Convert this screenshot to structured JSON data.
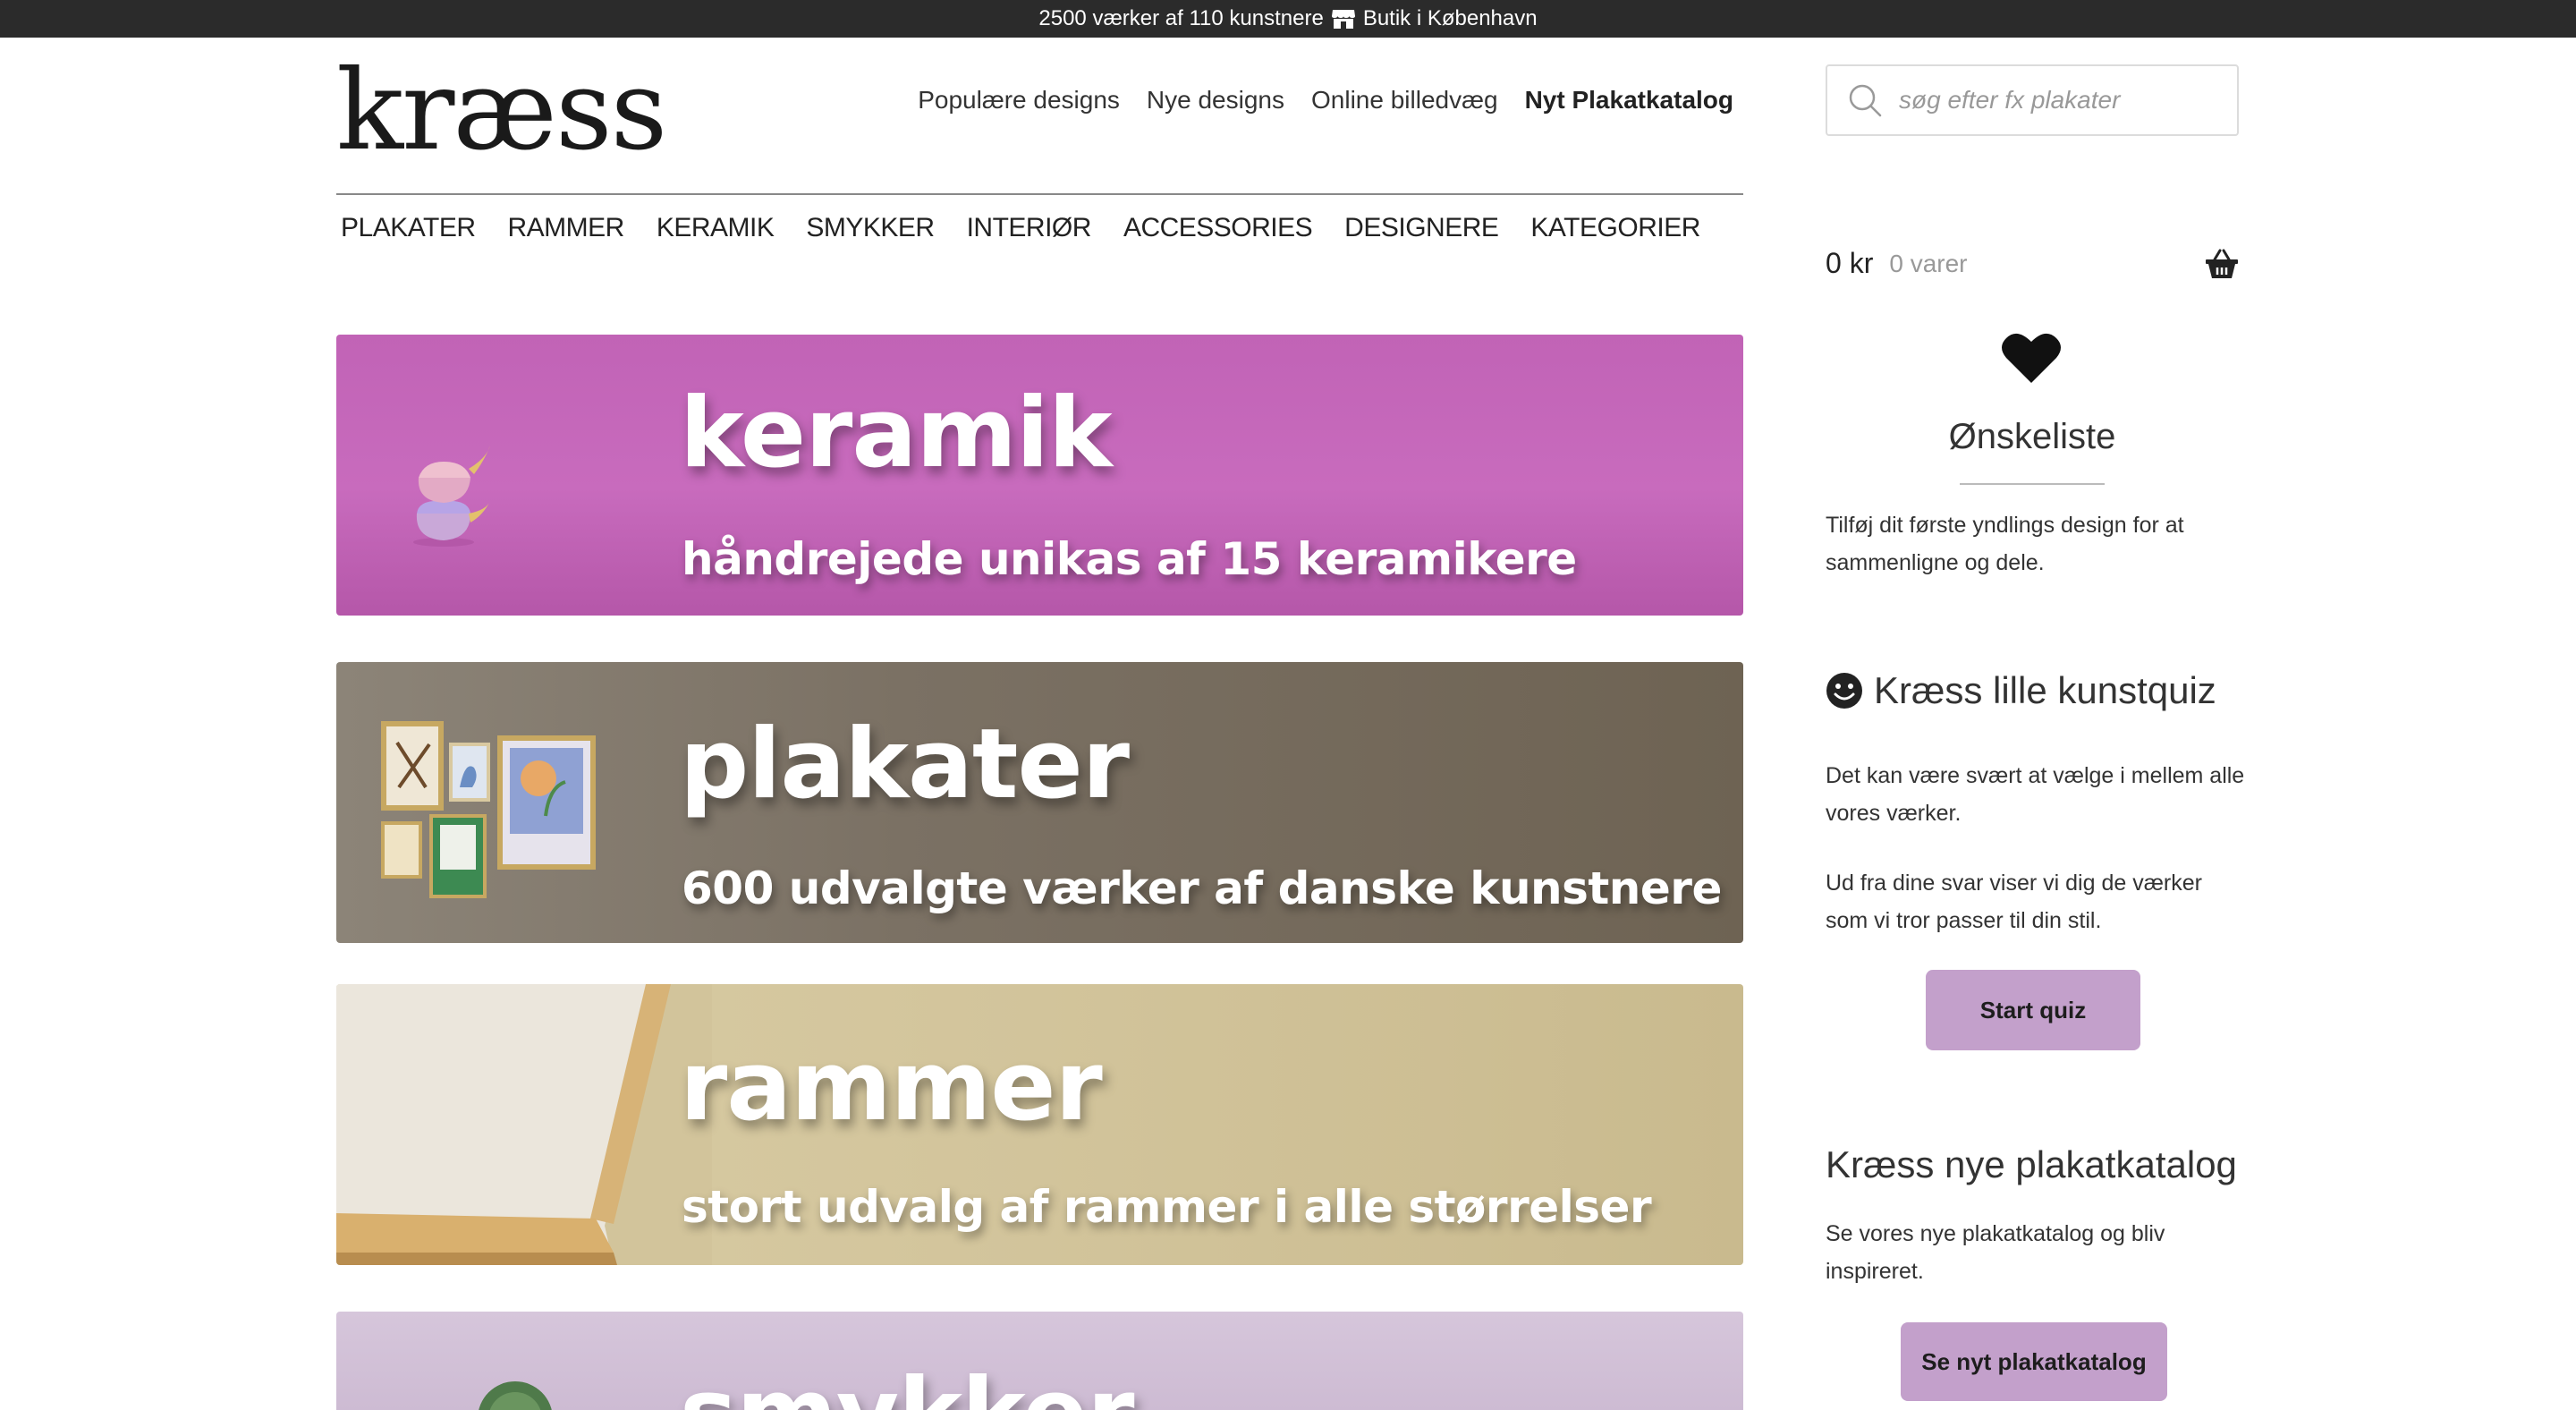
{
  "topbar": {
    "text_left": "2500 værker af 110 kunstnere",
    "text_right": "Butik i København",
    "icon": "shop-icon"
  },
  "header": {
    "logo": "kræss",
    "nav": [
      {
        "label": "Populære designs"
      },
      {
        "label": "Nye designs"
      },
      {
        "label": "Online billedvæg"
      },
      {
        "label": "Nyt Plakatkatalog"
      }
    ],
    "search": {
      "placeholder": "søg efter fx plakater",
      "icon": "search-icon"
    }
  },
  "categories": [
    "PLAKATER",
    "RAMMER",
    "KERAMIK",
    "SMYKKER",
    "INTERIØR",
    "ACCESSORIES",
    "DESIGNERE",
    "KATEGORIER"
  ],
  "banners": [
    {
      "title": "keramik",
      "subtitle": "håndrejede unikas af 15 keramikere",
      "color": "#c567b9"
    },
    {
      "title": "plakater",
      "subtitle": "600 udvalgte værker af danske kunstnere",
      "color": "#7b7164"
    },
    {
      "title": "rammer",
      "subtitle": "stort udvalg af rammer i alle størrelser",
      "color": "#d2c49b"
    },
    {
      "title": "smykker",
      "subtitle": "",
      "color": "#d0bfd5"
    }
  ],
  "sidebar": {
    "cart": {
      "amount": "0 kr",
      "count": "0 varer",
      "icon": "basket-icon"
    },
    "wishlist": {
      "icon": "heart-icon",
      "title": "Ønskeliste",
      "text": "Tilføj dit første yndlings design for at sammenligne og dele."
    },
    "quiz": {
      "icon": "smiley-icon",
      "title": "Kræss lille kunstquiz",
      "p1": "Det kan være svært at vælge i mellem alle vores værker.",
      "p2": "Ud fra dine svar viser vi dig de værker som vi tror passer til din stil.",
      "button": "Start quiz"
    },
    "catalog": {
      "title": "Kræss nye plakatkatalog",
      "text": "Se vores nye plakatkatalog og bliv inspireret.",
      "button": "Se nyt plakatkatalog"
    }
  },
  "colors": {
    "topbar": "#2b2b2b",
    "accent_button": "#c3a0cb"
  }
}
